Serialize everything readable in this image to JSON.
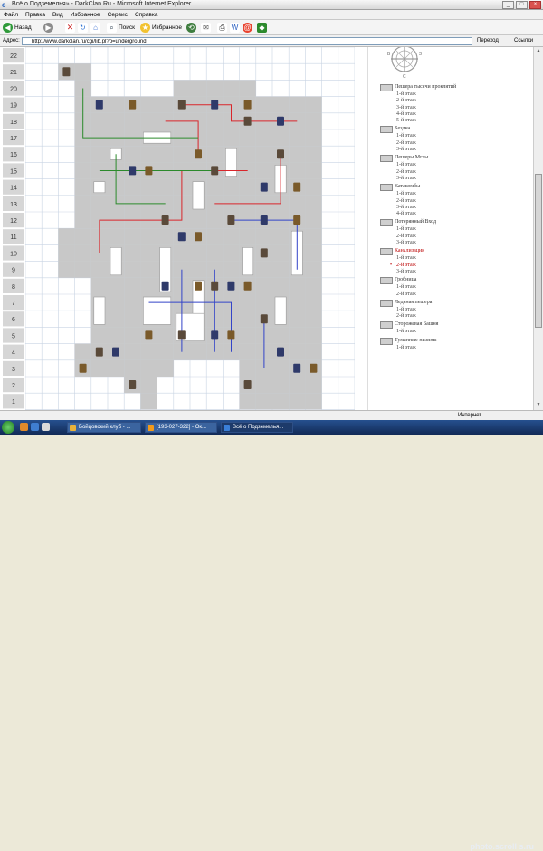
{
  "window": {
    "title": "Всё о Подземелья» - DarkClan.Ru - Microsoft Internet Explorer",
    "controls": [
      "_",
      "□",
      "×"
    ]
  },
  "menu": [
    "Файл",
    "Правка",
    "Вид",
    "Избранное",
    "Сервис",
    "Справка"
  ],
  "toolbar": {
    "back": "Назад",
    "search": "Поиск",
    "favorites": "Избранное"
  },
  "address": {
    "label": "Адрес:",
    "url": "http://www.darkclan.ru/cgi/lib.pl?p=underground",
    "go": "Переход",
    "links": "Ссылки"
  },
  "map": {
    "row_labels": [
      "22",
      "21",
      "20",
      "19",
      "18",
      "17",
      "16",
      "15",
      "14",
      "13",
      "12",
      "11",
      "10",
      "9",
      "8",
      "7",
      "6",
      "5",
      "4",
      "3",
      "2",
      "1"
    ],
    "colors": {
      "path": "#c8c8c8",
      "grid": "#c9d4e3",
      "label_bg": "#d6d6d6",
      "wall_red": "#d9262b",
      "wall_green": "#2c8a2c",
      "wall_blue": "#3344c8"
    }
  },
  "compass": {
    "west": "В",
    "east": "З",
    "south": "С"
  },
  "legend": [
    {
      "name": "Пещера тысячи проклятий",
      "icon": "rock-icon",
      "levels": [
        "1-й этаж",
        "2-й этаж",
        "3-й этаж",
        "4-й этаж",
        "5-й этаж"
      ]
    },
    {
      "name": "Бездна",
      "icon": "abyss-icon",
      "levels": [
        "1-й этаж",
        "2-й этаж",
        "3-й этаж"
      ]
    },
    {
      "name": "Пещеры Мглы",
      "icon": "mist-icon",
      "levels": [
        "1-й этаж",
        "2-й этаж",
        "3-й этаж"
      ]
    },
    {
      "name": "Катакомбы",
      "icon": "catacomb-icon",
      "levels": [
        "1-й этаж",
        "2-й этаж",
        "3-й этаж",
        "4-й этаж"
      ]
    },
    {
      "name": "Потерянный Вход",
      "icon": "lost-entrance-icon",
      "levels": [
        "1-й этаж",
        "2-й этаж",
        "3-й этаж"
      ]
    },
    {
      "name": "Канализация",
      "icon": "sewer-icon",
      "active": true,
      "active_level": 1,
      "levels": [
        "1-й этаж",
        "2-й этаж",
        "3-й этаж"
      ]
    },
    {
      "name": "Гробница",
      "icon": "tomb-icon",
      "levels": [
        "1-й этаж",
        "2-й этаж"
      ]
    },
    {
      "name": "Ледяная пещера",
      "icon": "ice-icon",
      "levels": [
        "1-й этаж",
        "2-й этаж"
      ]
    },
    {
      "name": "Сторожевая Башня",
      "icon": "tower-icon",
      "levels": [
        "1-й этаж"
      ]
    },
    {
      "name": "Туманные низины",
      "icon": "fog-icon",
      "levels": [
        "1-й этаж"
      ]
    }
  ],
  "status": {
    "zone": "Интернет"
  },
  "taskbar": {
    "tasks": [
      "Бойцовский клуб - ...",
      "[193-027-322] - Ок...",
      "Всё о Подземелья..."
    ],
    "watermark": "photo.scroll s.ru"
  }
}
